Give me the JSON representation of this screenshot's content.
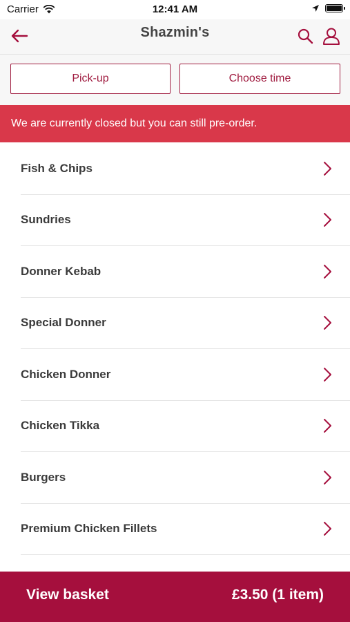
{
  "status_bar": {
    "carrier": "Carrier",
    "time": "12:41 AM"
  },
  "header": {
    "title": "Shazmin's"
  },
  "toolbar": {
    "pickup_label": "Pick-up",
    "choose_time_label": "Choose time"
  },
  "banner": {
    "text": "We are currently closed but you can still pre-order."
  },
  "menu": {
    "items": [
      {
        "label": "Fish & Chips"
      },
      {
        "label": "Sundries"
      },
      {
        "label": "Donner Kebab"
      },
      {
        "label": "Special Donner"
      },
      {
        "label": "Chicken Donner"
      },
      {
        "label": "Chicken Tikka"
      },
      {
        "label": "Burgers"
      },
      {
        "label": "Premium Chicken Fillets"
      }
    ]
  },
  "basket": {
    "label": "View basket",
    "total": "£3.50 (1 item)"
  },
  "colors": {
    "brand": "#a50f3d",
    "banner": "#d9384a",
    "header_bg": "#f7f7f7"
  },
  "icons": {
    "back": "arrow-left-icon",
    "search": "search-icon",
    "account": "account-icon",
    "chevron": "chevron-right-icon"
  }
}
